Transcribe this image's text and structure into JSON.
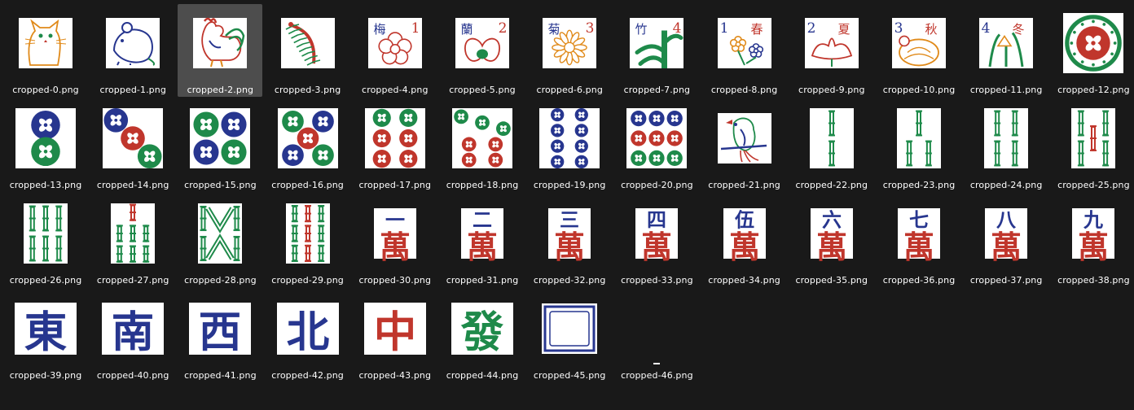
{
  "explorer": {
    "selected_index": 2,
    "files": [
      {
        "name": "cropped-0.png",
        "icon": "cat-tile-icon",
        "kind": "pic",
        "art": "cat"
      },
      {
        "name": "cropped-1.png",
        "icon": "rat-tile-icon",
        "kind": "pic",
        "art": "rat"
      },
      {
        "name": "cropped-2.png",
        "icon": "rooster-tile-icon",
        "kind": "pic",
        "art": "rooster"
      },
      {
        "name": "cropped-3.png",
        "icon": "centipede-tile-icon",
        "kind": "pic",
        "art": "centipede"
      },
      {
        "name": "cropped-4.png",
        "icon": "plum-flower-tile-icon",
        "kind": "flower",
        "hanzi": "梅",
        "num": "1",
        "style": "flower",
        "color": "#c0362c",
        "num_left": false
      },
      {
        "name": "cropped-5.png",
        "icon": "orchid-flower-tile-icon",
        "kind": "flower",
        "hanzi": "蘭",
        "num": "2",
        "style": "orchid",
        "color": "#c0362c",
        "num_left": false
      },
      {
        "name": "cropped-6.png",
        "icon": "chrysanthemum-flower-tile-icon",
        "kind": "flower",
        "hanzi": "菊",
        "num": "3",
        "style": "chrys",
        "color": "#e08a1a",
        "num_left": false
      },
      {
        "name": "cropped-7.png",
        "icon": "bamboo-flower-tile-icon",
        "kind": "flower",
        "hanzi": "竹",
        "num": "4",
        "style": "bamboo",
        "color": "#1e8a4a",
        "num_left": false
      },
      {
        "name": "cropped-8.png",
        "icon": "spring-season-tile-icon",
        "kind": "flower",
        "hanzi": "春",
        "num": "1",
        "style": "spring",
        "color": "#c0362c",
        "num_left": true
      },
      {
        "name": "cropped-9.png",
        "icon": "summer-season-tile-icon",
        "kind": "flower",
        "hanzi": "夏",
        "num": "2",
        "style": "lotus",
        "color": "#c0362c",
        "num_left": true
      },
      {
        "name": "cropped-10.png",
        "icon": "autumn-season-tile-icon",
        "kind": "flower",
        "hanzi": "秋",
        "num": "3",
        "style": "autumn",
        "color": "#e08a1a",
        "num_left": true
      },
      {
        "name": "cropped-11.png",
        "icon": "winter-season-tile-icon",
        "kind": "flower",
        "hanzi": "冬",
        "num": "4",
        "style": "winter",
        "color": "#1e8a4a",
        "num_left": true
      },
      {
        "name": "cropped-12.png",
        "icon": "one-dot-tile-icon",
        "kind": "dots",
        "n": 1
      },
      {
        "name": "cropped-13.png",
        "icon": "two-dots-tile-icon",
        "kind": "dots",
        "n": 2
      },
      {
        "name": "cropped-14.png",
        "icon": "three-dots-tile-icon",
        "kind": "dots",
        "n": 3
      },
      {
        "name": "cropped-15.png",
        "icon": "four-dots-tile-icon",
        "kind": "dots",
        "n": 4
      },
      {
        "name": "cropped-16.png",
        "icon": "five-dots-tile-icon",
        "kind": "dots",
        "n": 5
      },
      {
        "name": "cropped-17.png",
        "icon": "six-dots-tile-icon",
        "kind": "dots",
        "n": 6
      },
      {
        "name": "cropped-18.png",
        "icon": "seven-dots-tile-icon",
        "kind": "dots",
        "n": 7
      },
      {
        "name": "cropped-19.png",
        "icon": "eight-dots-tile-icon",
        "kind": "dots",
        "n": 8
      },
      {
        "name": "cropped-20.png",
        "icon": "nine-dots-tile-icon",
        "kind": "dots",
        "n": 9
      },
      {
        "name": "cropped-21.png",
        "icon": "bird-one-bamboo-tile-icon",
        "kind": "pic",
        "art": "bird"
      },
      {
        "name": "cropped-22.png",
        "icon": "two-bamboo-tile-icon",
        "kind": "bamboo",
        "n": 2
      },
      {
        "name": "cropped-23.png",
        "icon": "three-bamboo-tile-icon",
        "kind": "bamboo",
        "n": 3
      },
      {
        "name": "cropped-24.png",
        "icon": "four-bamboo-tile-icon",
        "kind": "bamboo",
        "n": 4
      },
      {
        "name": "cropped-25.png",
        "icon": "five-bamboo-tile-icon",
        "kind": "bamboo",
        "n": 5
      },
      {
        "name": "cropped-26.png",
        "icon": "six-bamboo-tile-icon",
        "kind": "bamboo",
        "n": 6
      },
      {
        "name": "cropped-27.png",
        "icon": "seven-bamboo-tile-icon",
        "kind": "bamboo",
        "n": 7
      },
      {
        "name": "cropped-28.png",
        "icon": "eight-bamboo-tile-icon",
        "kind": "bamboo",
        "n": 8
      },
      {
        "name": "cropped-29.png",
        "icon": "nine-bamboo-tile-icon",
        "kind": "bamboo",
        "n": 9
      },
      {
        "name": "cropped-30.png",
        "icon": "one-character-tile-icon",
        "kind": "char",
        "numeral": "一"
      },
      {
        "name": "cropped-31.png",
        "icon": "two-character-tile-icon",
        "kind": "char",
        "numeral": "二"
      },
      {
        "name": "cropped-32.png",
        "icon": "three-character-tile-icon",
        "kind": "char",
        "numeral": "三"
      },
      {
        "name": "cropped-33.png",
        "icon": "four-character-tile-icon",
        "kind": "char",
        "numeral": "四"
      },
      {
        "name": "cropped-34.png",
        "icon": "five-character-tile-icon",
        "kind": "char",
        "numeral": "伍"
      },
      {
        "name": "cropped-35.png",
        "icon": "six-character-tile-icon",
        "kind": "char",
        "numeral": "六"
      },
      {
        "name": "cropped-36.png",
        "icon": "seven-character-tile-icon",
        "kind": "char",
        "numeral": "七"
      },
      {
        "name": "cropped-37.png",
        "icon": "eight-character-tile-icon",
        "kind": "char",
        "numeral": "八"
      },
      {
        "name": "cropped-38.png",
        "icon": "nine-character-tile-icon",
        "kind": "char",
        "numeral": "九"
      },
      {
        "name": "cropped-39.png",
        "icon": "east-wind-tile-icon",
        "kind": "big",
        "glyph": "東",
        "color": "#27368f"
      },
      {
        "name": "cropped-40.png",
        "icon": "south-wind-tile-icon",
        "kind": "big",
        "glyph": "南",
        "color": "#27368f"
      },
      {
        "name": "cropped-41.png",
        "icon": "west-wind-tile-icon",
        "kind": "big",
        "glyph": "西",
        "color": "#27368f"
      },
      {
        "name": "cropped-42.png",
        "icon": "north-wind-tile-icon",
        "kind": "big",
        "glyph": "北",
        "color": "#27368f"
      },
      {
        "name": "cropped-43.png",
        "icon": "red-dragon-tile-icon",
        "kind": "big",
        "glyph": "中",
        "color": "#c0362c"
      },
      {
        "name": "cropped-44.png",
        "icon": "green-dragon-tile-icon",
        "kind": "big",
        "glyph": "發",
        "color": "#1e8a4a"
      },
      {
        "name": "cropped-45.png",
        "icon": "white-dragon-tile-icon",
        "kind": "frame"
      },
      {
        "name": "cropped-46.png",
        "icon": "blank-image-icon",
        "kind": "blank"
      }
    ]
  },
  "colors": {
    "background": "#191919",
    "selection": "#4d4d4d",
    "tile_red": "#c0362c",
    "tile_blue": "#27368f",
    "tile_green": "#1e8a4a",
    "tile_orange": "#e08a1a",
    "tile_white": "#ffffff"
  }
}
